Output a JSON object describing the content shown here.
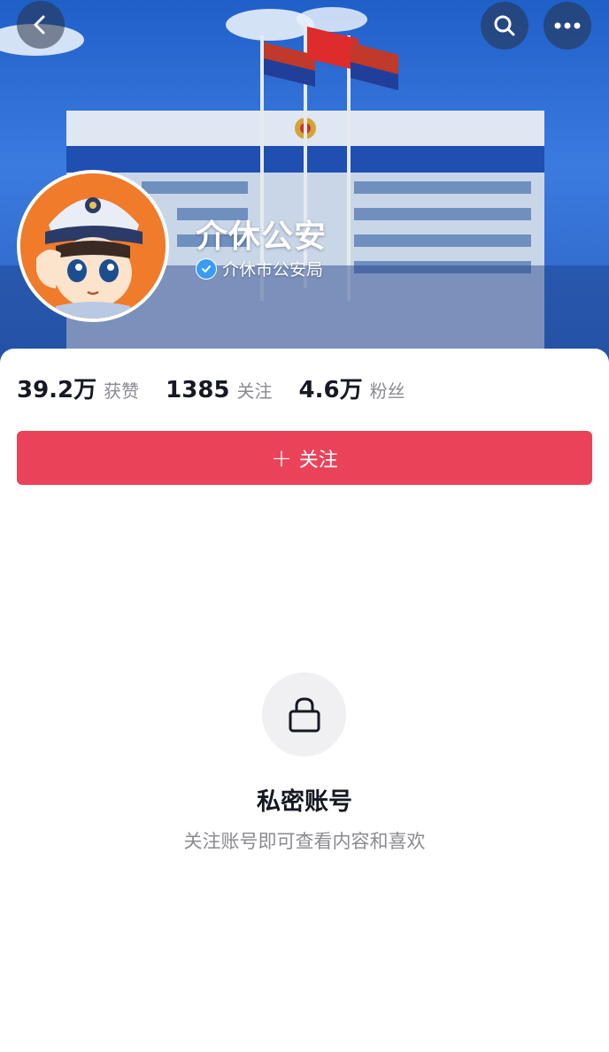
{
  "header": {
    "account_name": "介休公安",
    "verified_label": "介休市公安局",
    "icons": {
      "back": "chevron-left-icon",
      "search": "search-icon",
      "more": "more-dots-icon",
      "verified": "verified-check-icon"
    }
  },
  "stats": [
    {
      "value": "39.2万",
      "label": "获赞"
    },
    {
      "value": "1385",
      "label": "关注"
    },
    {
      "value": "4.6万",
      "label": "粉丝"
    }
  ],
  "follow_button": {
    "plus": "+",
    "label": "关注"
  },
  "private_notice": {
    "title": "私密账号",
    "description": "关注账号即可查看内容和喜欢"
  },
  "colors": {
    "follow_button": "#ea4359",
    "header_blue": "#2a62bf",
    "verified_badge": "#3a9bf2",
    "avatar_bg": "#f07b2a"
  }
}
